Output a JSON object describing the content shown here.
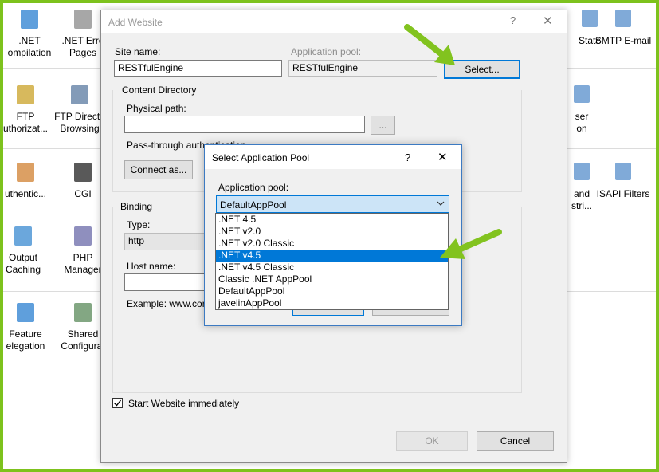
{
  "background": {
    "tiles": [
      {
        "label": ".NET Compilation",
        "display": ".NET\nompilation",
        "icon": "net-compilation-icon"
      },
      {
        "label": ".NET Error Pages",
        "display": ".NET Erro\nPages",
        "icon": "error-pages-icon"
      },
      {
        "label": "FTP Authorization",
        "display": "FTP\nuthorizat...",
        "icon": "ftp-authorization-icon"
      },
      {
        "label": "FTP Directory Browsing",
        "display": "FTP Directo\nBrowsing",
        "icon": "ftp-browsing-icon"
      },
      {
        "label": "Authentication",
        "display": "uthentic...",
        "icon": "authentication-icon"
      },
      {
        "label": "CGI",
        "display": "CGI",
        "icon": "cgi-icon"
      },
      {
        "label": "Output Caching",
        "display": "Output\nCaching",
        "icon": "output-caching-icon"
      },
      {
        "label": "PHP Manager",
        "display": "PHP\nManager",
        "icon": "php-manager-icon"
      },
      {
        "label": "Feature Delegation",
        "display": "Feature\nelegation",
        "icon": "feature-delegation-icon"
      },
      {
        "label": "Shared Configuration",
        "display": "Shared\nConfigurat",
        "icon": "shared-config-icon"
      }
    ],
    "right_tiles": [
      {
        "display": "State",
        "icon": "state-icon"
      },
      {
        "display": "SMTP E-mail",
        "icon": "smtp-icon"
      },
      {
        "display": "ser\non",
        "icon": "user-icon"
      },
      {
        "display": "and\nstri...",
        "icon": "handler-icon"
      },
      {
        "display": "ISAPI Filters",
        "icon": "isapi-filters-icon"
      }
    ]
  },
  "add_website": {
    "title": "Add Website",
    "help_glyph": "?",
    "close_glyph": "✕",
    "site_name_label": "Site name:",
    "site_name_value": "RESTfulEngine",
    "app_pool_label": "Application pool:",
    "app_pool_value": "RESTfulEngine",
    "select_button": "Select...",
    "content_directory_label": "Content Directory",
    "physical_path_label": "Physical path:",
    "physical_path_value": "",
    "browse_button": "...",
    "pass_through_label": "Pass-through authentication",
    "connect_as_button": "Connect as...",
    "binding_label": "Binding",
    "type_label": "Type:",
    "type_value": "http",
    "host_name_label": "Host name:",
    "host_name_value": "",
    "example_text": "Example: www.con",
    "start_immediately_label": "Start Website immediately",
    "start_immediately_checked": true,
    "ok_button": "OK",
    "cancel_button": "Cancel"
  },
  "select_app_pool": {
    "title": "Select Application Pool",
    "help_glyph": "?",
    "close_glyph": "✕",
    "pool_label": "Application pool:",
    "selected_value": "DefaultAppPool",
    "options": [
      {
        "label": ".NET 4.5",
        "highlighted": false
      },
      {
        "label": ".NET v2.0",
        "highlighted": false
      },
      {
        "label": ".NET v2.0 Classic",
        "highlighted": false
      },
      {
        "label": ".NET v4.5",
        "highlighted": true
      },
      {
        "label": ".NET v4.5 Classic",
        "highlighted": false
      },
      {
        "label": "Classic .NET AppPool",
        "highlighted": false
      },
      {
        "label": "DefaultAppPool",
        "highlighted": false
      },
      {
        "label": "javelinAppPool",
        "highlighted": false
      }
    ]
  },
  "colors": {
    "frame": "#7dc21d",
    "accent": "#0078d7",
    "arrow": "#82c31f"
  }
}
